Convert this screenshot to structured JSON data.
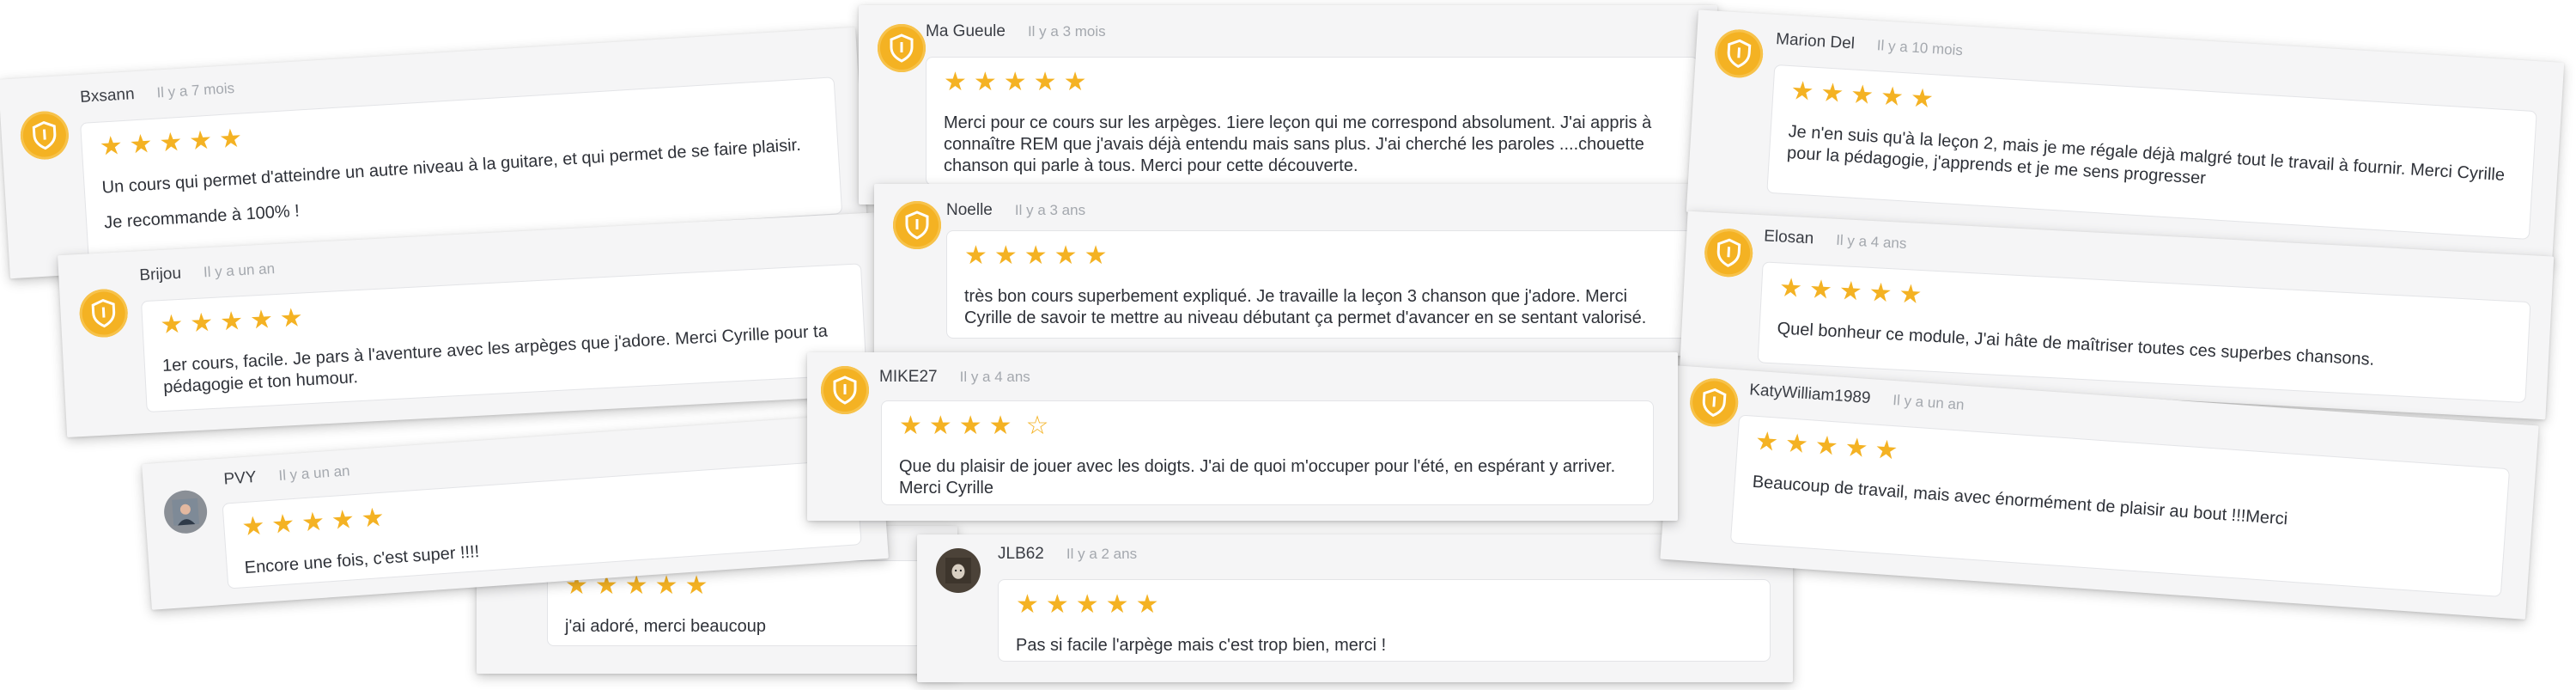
{
  "colors": {
    "accent": "#f4b223",
    "card_bg": "#f5f5f6",
    "text": "#2e3138",
    "date": "#a4a8ae"
  },
  "reviews": [
    {
      "author": "Bxsann",
      "date": "Il y a 7 mois",
      "stars": "★★★★★",
      "avatar": "shield-icon",
      "text1": "Un cours qui permet d'atteindre un autre niveau à la guitare, et qui permet de se faire plaisir.",
      "text2": "Je recommande à 100% !"
    },
    {
      "author": "Ma Gueule",
      "date": "Il y a 3 mois",
      "stars": "★★★★★",
      "avatar": "shield-icon",
      "text1": "Merci pour ce cours sur les arpèges. 1iere leçon qui me correspond absolument. J'ai appris à connaître REM que j'avais déjà entendu mais sans plus. J'ai cherché les paroles ....chouette chanson qui parle à tous. Merci pour cette découverte."
    },
    {
      "author": "Marion Del",
      "date": "Il y a 10 mois",
      "stars": "★★★★★",
      "avatar": "shield-icon",
      "text1": "Je n'en suis qu'à la leçon 2, mais je me régale déjà malgré tout le travail à fournir. Merci Cyrille pour la pédagogie, j'apprends et je me sens progresser"
    },
    {
      "author": "Brijou",
      "date": "Il y a un an",
      "stars": "★★★★★",
      "avatar": "shield-icon",
      "text1": "1er cours, facile. Je pars à l'aventure avec les arpèges que j'adore. Merci Cyrille pour ta pédagogie et ton humour."
    },
    {
      "author": "Noelle",
      "date": "Il y a 3 ans",
      "stars": "★★★★★",
      "avatar": "shield-icon",
      "text1": "très bon cours superbement expliqué. Je travaille la leçon 3 chanson que j'adore. Merci Cyrille de savoir te mettre au niveau débutant ça permet d'avancer en se sentant valorisé."
    },
    {
      "author": "Elosan",
      "date": "Il y a 4 ans",
      "stars": "★★★★★",
      "avatar": "shield-icon",
      "text1": "Quel bonheur ce module, J'ai hâte de maîtriser toutes ces superbes chansons."
    },
    {
      "author": "MIKE27",
      "date": "Il y a 4 ans",
      "stars": "★★★★",
      "empty_star": "☆",
      "avatar": "shield-icon",
      "text1": "Que du plaisir de jouer avec les doigts. J'ai de quoi m'occuper pour l'été, en espérant y arriver. Merci Cyrille"
    },
    {
      "author": "KatyWilliam1989",
      "date": "Il y a un an",
      "stars": "★★★★★",
      "avatar": "shield-icon",
      "text1": "Beaucoup de travail, mais avec énormément de plaisir au bout !!!Merci"
    },
    {
      "author": "PVY",
      "date": "Il y a un an",
      "stars": "★★★★★",
      "avatar": "user-photo",
      "text1": "Encore une fois, c'est super !!!!"
    },
    {
      "author": "",
      "date": "",
      "stars": "★★★★★",
      "avatar": "",
      "text1": "j'ai adoré, merci beaucoup"
    },
    {
      "author": "JLB62",
      "date": "Il y a 2 ans",
      "stars": "★★★★★",
      "avatar": "dog-photo",
      "text1": "Pas si facile l'arpège mais c'est trop bien, merci !"
    }
  ]
}
